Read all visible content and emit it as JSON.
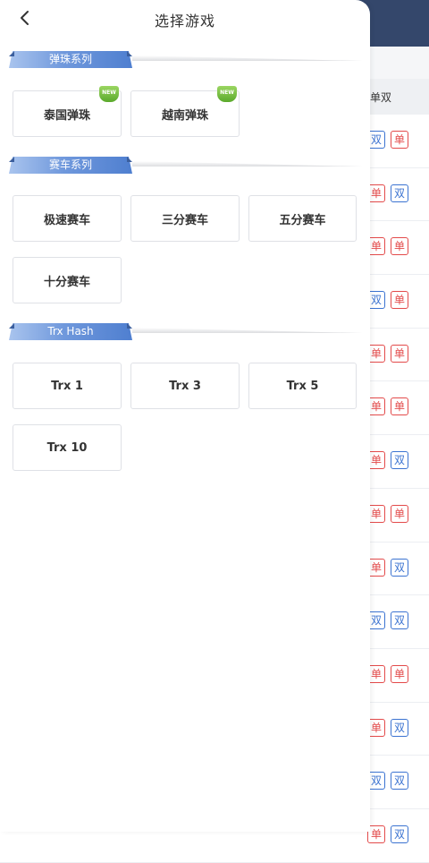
{
  "header": {
    "title": "选择游戏"
  },
  "sections": [
    {
      "title": "弹珠系列",
      "games": [
        {
          "label": "泰国弹珠",
          "badge": "NEW"
        },
        {
          "label": "越南弹珠",
          "badge": "NEW"
        }
      ]
    },
    {
      "title": "赛车系列",
      "games": [
        {
          "label": "极速赛车"
        },
        {
          "label": "三分赛车"
        },
        {
          "label": "五分赛车"
        },
        {
          "label": "十分赛车"
        }
      ]
    },
    {
      "title": "Trx Hash",
      "games": [
        {
          "label": "Trx 1"
        },
        {
          "label": "Trx 3"
        },
        {
          "label": "Trx 5"
        },
        {
          "label": "Trx 10"
        }
      ]
    }
  ],
  "background": {
    "column_header": "单双",
    "rows": [
      [
        "双",
        "单"
      ],
      [
        "单",
        "双"
      ],
      [
        "单",
        "单"
      ],
      [
        "双",
        "单"
      ],
      [
        "单",
        "单"
      ],
      [
        "单",
        "单"
      ],
      [
        "单",
        "双"
      ],
      [
        "单",
        "单"
      ],
      [
        "单",
        "双"
      ],
      [
        "双",
        "双"
      ],
      [
        "单",
        "单"
      ],
      [
        "单",
        "双"
      ],
      [
        "双",
        "双"
      ],
      [
        "单",
        "双"
      ]
    ]
  },
  "colors": {
    "accent": "#4f7fd0",
    "header_bg": "#34476b",
    "odd": "#e34a4a",
    "even": "#3b73d1",
    "new_badge": "#5aa92b"
  },
  "icons": {
    "back": "chevron-left-icon",
    "calendar": "calendar-icon",
    "new": "new-badge-icon"
  }
}
